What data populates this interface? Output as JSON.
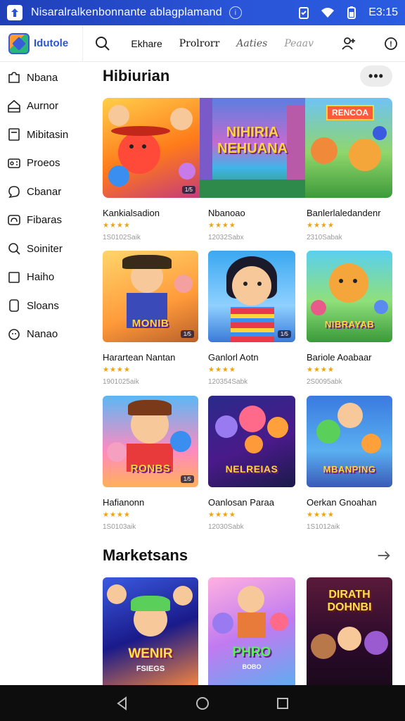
{
  "status": {
    "title": "Nisaralralkenbonnante ablagplamand",
    "time": "E3:15"
  },
  "header": {
    "app_name": "Idutole",
    "tabs": [
      "Ekhare",
      "Prolrorr",
      "Aaties",
      "Peaav"
    ]
  },
  "sidebar": {
    "items": [
      {
        "label": "Nbana",
        "icon": "puzzle-icon"
      },
      {
        "label": "Aurnor",
        "icon": "home-icon"
      },
      {
        "label": "Mibitasin",
        "icon": "card-icon"
      },
      {
        "label": "Proeos",
        "icon": "gamepad-icon"
      },
      {
        "label": "Cbanar",
        "icon": "chat-icon"
      },
      {
        "label": "Fibaras",
        "icon": "tv-icon"
      },
      {
        "label": "Soiniter",
        "icon": "search-icon"
      },
      {
        "label": "Haiho",
        "icon": "tablet-icon"
      },
      {
        "label": "Sloans",
        "icon": "phone-icon"
      },
      {
        "label": "Nanao",
        "icon": "emoji-icon"
      }
    ]
  },
  "section1": {
    "title": "Hibiurian",
    "more_label": "•••",
    "banner": {
      "main_title": "NIHIRIA NEHUANA",
      "corner_tag": "RENCOA",
      "badge": "1/5"
    },
    "row_top": [
      {
        "title": "Kankialsadion",
        "stars": "★★★★",
        "meta": "1S0102Saik"
      },
      {
        "title": "Nbanoao",
        "stars": "★★★★",
        "meta": "12032Sabx"
      },
      {
        "title": "Banlerlaledandenr",
        "stars": "★★★★",
        "meta": "2310Sabak"
      }
    ],
    "grid": [
      {
        "thumb": "MONIB",
        "title": "Harartean Nantan",
        "stars": "★★★★",
        "meta": "1901025aik",
        "badge": "1/5"
      },
      {
        "thumb": "",
        "title": "Ganlorl Aotn",
        "stars": "★★★★",
        "meta": "120354Sabk",
        "badge": "1/5"
      },
      {
        "thumb": "NIBRAYAB",
        "title": "Bariole Aoabaar",
        "stars": "★★★★",
        "meta": "2S0095abk"
      },
      {
        "thumb": "RONBS",
        "title": "Hafianonn",
        "stars": "★★★★",
        "meta": "1S0103aik",
        "badge": "1/5"
      },
      {
        "thumb": "NELREIAS",
        "title": "Oanlosan Paraa",
        "stars": "★★★★",
        "meta": "12030Sabk"
      },
      {
        "thumb": "MBANPING",
        "title": "Oerkan Gnoahan",
        "stars": "★★★★",
        "meta": "1S1012aik"
      }
    ]
  },
  "section2": {
    "title": "Marketsans",
    "cards": [
      {
        "title": "WENIR",
        "sub": "FSIEGS"
      },
      {
        "title": "PHRO",
        "sub": "BOBO"
      },
      {
        "title": "DIRATH DOHNBI",
        "sub": ""
      }
    ]
  }
}
